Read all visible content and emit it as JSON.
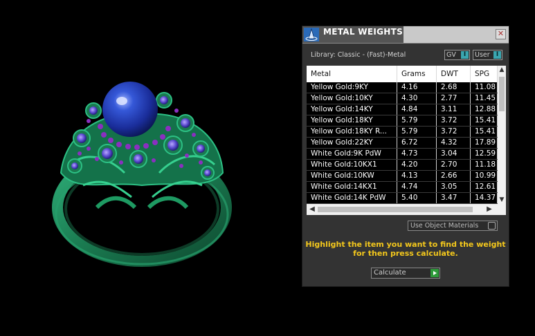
{
  "window": {
    "title": "METAL WEIGHTS",
    "close_glyph": "✕",
    "library_label": "Library: Classic - (Fast)-Metal",
    "toggles": {
      "gv_label": "GV",
      "user_label": "User",
      "knob_glyph": "I"
    }
  },
  "table": {
    "columns": [
      "Metal",
      "Grams",
      "DWT",
      "SPG"
    ],
    "rows": [
      [
        "Yellow Gold:9KY",
        "4.16",
        "2.68",
        "11.08"
      ],
      [
        "Yellow Gold:10KY",
        "4.30",
        "2.77",
        "11.45"
      ],
      [
        "Yellow Gold:14KY",
        "4.84",
        "3.11",
        "12.88"
      ],
      [
        "Yellow Gold:18KY",
        "5.79",
        "3.72",
        "15.41"
      ],
      [
        "Yellow Gold:18KY R...",
        "5.79",
        "3.72",
        "15.41"
      ],
      [
        "Yellow Gold:22KY",
        "6.72",
        "4.32",
        "17.89"
      ],
      [
        "White Gold:9K PdW",
        "4.73",
        "3.04",
        "12.59"
      ],
      [
        "White Gold:10KX1",
        "4.20",
        "2.70",
        "11.18"
      ],
      [
        "White Gold:10KW",
        "4.13",
        "2.66",
        "10.99"
      ],
      [
        "White Gold:14KX1",
        "4.74",
        "3.05",
        "12.61"
      ],
      [
        "White Gold:14K PdW",
        "5.40",
        "3.47",
        "14.37"
      ]
    ],
    "scroll_up": "▲",
    "scroll_down": "▼",
    "scroll_left": "◀",
    "scroll_right": "▶"
  },
  "use_object_materials_label": "Use Object Materials",
  "instruction_line1": "Highlight the item you want to find the weight",
  "instruction_line2": "for then press calculate.",
  "calculate_label": "Calculate",
  "colors": {
    "ring_metal": "#1f8a5a",
    "pearl": "#1f3aa8",
    "accent_gems": "#8a2fc0",
    "instruction_text": "#f4c81c"
  }
}
